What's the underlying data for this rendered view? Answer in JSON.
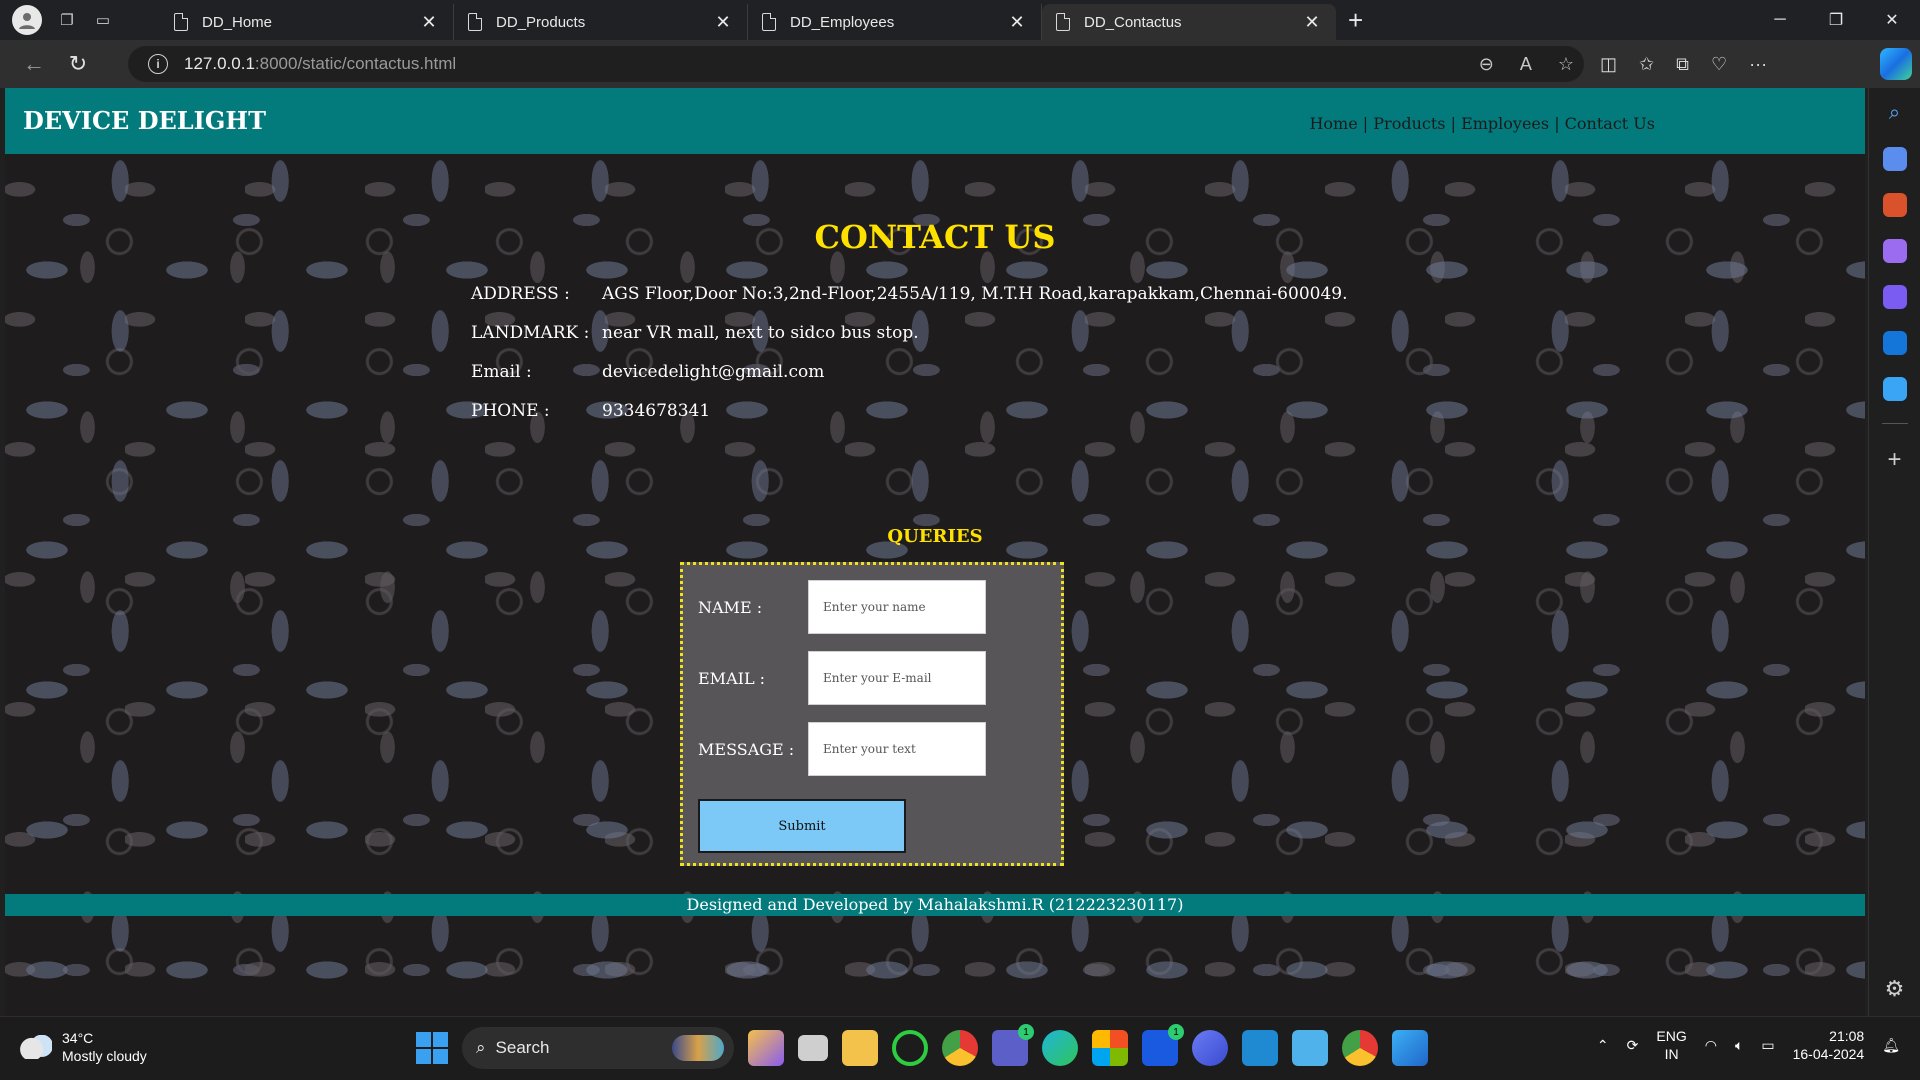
{
  "browser": {
    "tabs": [
      {
        "label": "DD_Home",
        "active": false
      },
      {
        "label": "DD_Products",
        "active": false
      },
      {
        "label": "DD_Employees",
        "active": false
      },
      {
        "label": "DD_Contactus",
        "active": true
      }
    ],
    "url_host": "127.0.0.1",
    "url_path": ":8000/static/contactus.html"
  },
  "site": {
    "brand": "DEVICE DELIGHT",
    "nav": {
      "home": "Home",
      "products": "Products",
      "employees": "Employees",
      "contact": "Contact Us",
      "separator": "|"
    },
    "title": "CONTACT US",
    "info": {
      "address_label": "ADDRESS :",
      "address": "AGS Floor,Door No:3,2nd-Floor,2455A/119, M.T.H Road,karapakkam,Chennai-600049.",
      "landmark_label": "LANDMARK :",
      "landmark": "near VR mall, next to sidco bus stop.",
      "email_label": "Email :",
      "email": "devicedelight@gmail.com",
      "phone_label": "PHONE :",
      "phone": "9334678341"
    },
    "queries": {
      "title": "QUERIES",
      "name_label": "NAME :",
      "name_placeholder": "Enter your name",
      "email_label": "EMAIL :",
      "email_placeholder": "Enter your E-mail",
      "message_label": "MESSAGE :",
      "message_placeholder": "Enter your text",
      "submit_label": "Submit"
    },
    "footer": "Designed and Developed by Mahalakshmi.R (212223230117)"
  },
  "taskbar": {
    "weather_temp": "34°C",
    "weather_desc": "Mostly cloudy",
    "search_label": "Search",
    "lang_1": "ENG",
    "lang_2": "IN",
    "time": "21:08",
    "date": "16-04-2024",
    "badge_teams": "1",
    "badge_l": "1"
  },
  "colors": {
    "header_teal": "#037b7d",
    "title_yellow": "#ffe100",
    "submit_blue": "#7cc9f7",
    "form_bg": "#575557"
  }
}
